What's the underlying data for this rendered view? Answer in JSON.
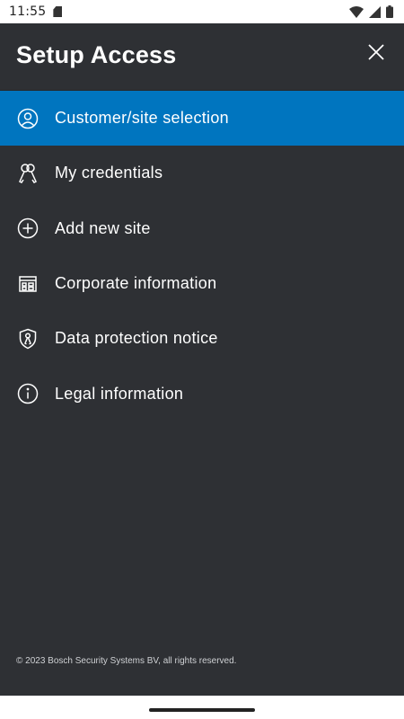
{
  "status_bar": {
    "time": "11:55",
    "icons": [
      "sd-card-icon",
      "wifi-icon",
      "signal-icon",
      "battery-icon"
    ]
  },
  "drawer": {
    "title": "Setup Access",
    "close_icon": "close-icon",
    "items": [
      {
        "label": "Customer/site selection",
        "icon": "user-circle-icon",
        "active": true
      },
      {
        "label": "My credentials",
        "icon": "keys-icon",
        "active": false
      },
      {
        "label": "Add new site",
        "icon": "plus-circle-icon",
        "active": false
      },
      {
        "label": "Corporate information",
        "icon": "building-icon",
        "active": false
      },
      {
        "label": "Data protection notice",
        "icon": "shield-icon",
        "active": false
      },
      {
        "label": "Legal information",
        "icon": "info-circle-icon",
        "active": false
      }
    ],
    "footer": "© 2023 Bosch Security Systems BV, all rights reserved."
  },
  "colors": {
    "background": "#2e3034",
    "active_item": "#0075bf",
    "text": "#ffffff"
  }
}
